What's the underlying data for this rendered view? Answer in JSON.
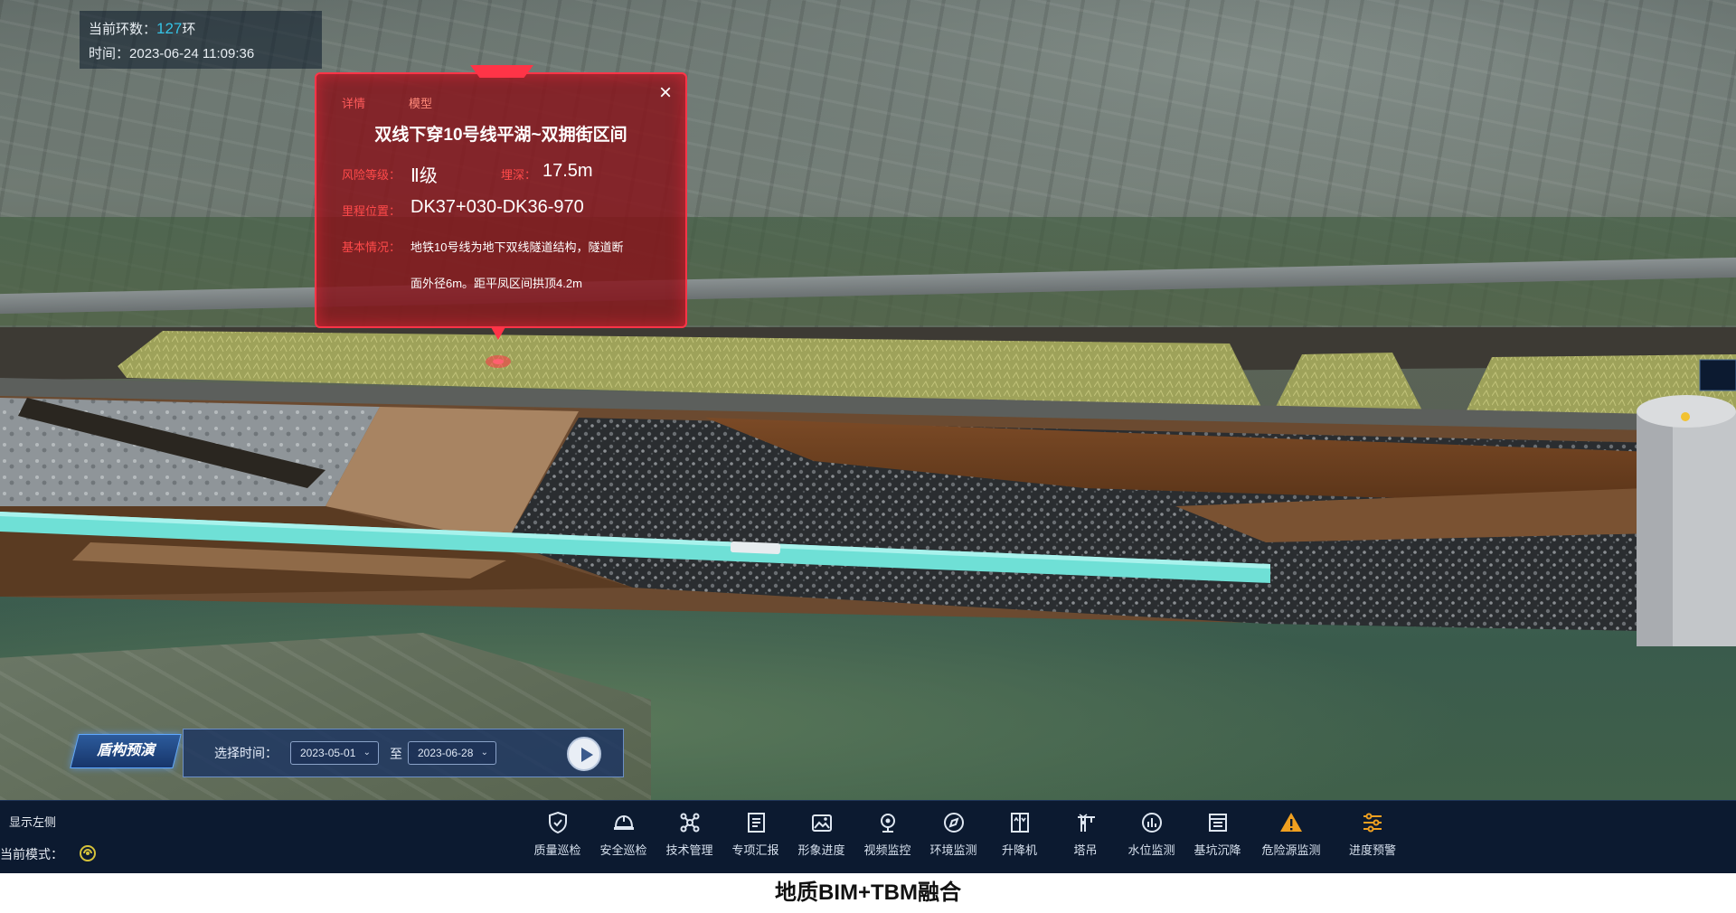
{
  "status": {
    "ring_label": "当前环数：",
    "ring_value": "127",
    "ring_unit": "环",
    "time_label": "时间：",
    "time_value": "2023-06-24 11:09:36"
  },
  "popup": {
    "tabs": [
      "详情",
      "模型"
    ],
    "title": "双线下穿10号线平湖~双拥街区间",
    "risk_label": "风险等级：",
    "risk_value": "Ⅱ级",
    "depth_label": "埋深：",
    "depth_value": "17.5m",
    "mileage_label": "里程位置：",
    "mileage_value": "DK37+030-DK36-970",
    "basic_label": "基本情况：",
    "basic_line1": "地铁10号线为地下双线隧道结构，隧道断",
    "basic_line2": "面外径6m。距平凤区间拱顶4.2m"
  },
  "playback": {
    "button_label": "盾构预演",
    "time_label": "选择时间：",
    "start_date": "2023-05-01",
    "to_label": "至",
    "end_date": "2023-06-28"
  },
  "toolbar": {
    "show_left": "显示左侧",
    "mode_label": "当前模式：",
    "items": [
      {
        "label": "质量巡检",
        "icon": "shield-check-icon"
      },
      {
        "label": "安全巡检",
        "icon": "helmet-icon"
      },
      {
        "label": "技术管理",
        "icon": "network-icon"
      },
      {
        "label": "专项汇报",
        "icon": "report-icon"
      },
      {
        "label": "形象进度",
        "icon": "image-progress-icon"
      },
      {
        "label": "视频监控",
        "icon": "camera-icon"
      },
      {
        "label": "环境监测",
        "icon": "compass-icon"
      },
      {
        "label": "升降机",
        "icon": "elevator-icon"
      },
      {
        "label": "塔吊",
        "icon": "tower-crane-icon"
      },
      {
        "label": "水位监测",
        "icon": "water-level-icon"
      },
      {
        "label": "基坑沉降",
        "icon": "settlement-icon"
      },
      {
        "label": "危险源监测",
        "icon": "warning-icon"
      },
      {
        "label": "进度预警",
        "icon": "sliders-icon"
      }
    ]
  },
  "caption": "地质BIM+TBM融合",
  "colors": {
    "popup_border": "#ff3447",
    "popup_bg": "#87121a",
    "accent_blue": "#35c3e6",
    "toolbar_bg": "#0c1a30",
    "tunnel": "#6fe0d6",
    "warning": "#f0a020"
  }
}
